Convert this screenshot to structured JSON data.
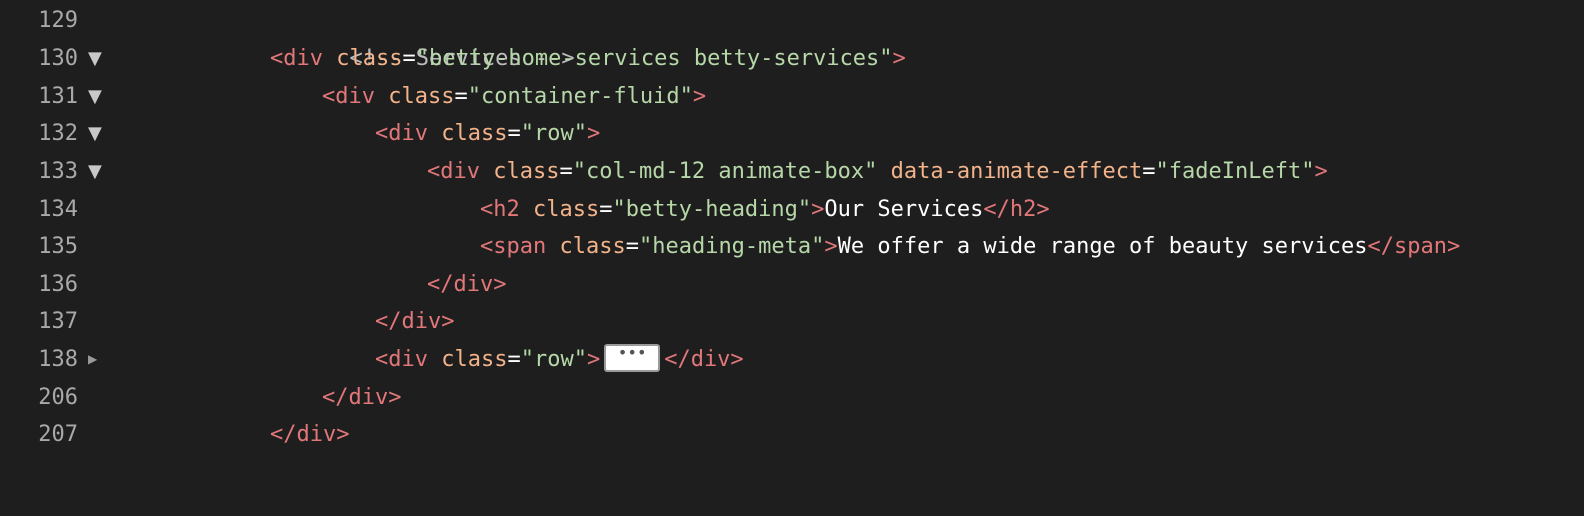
{
  "editor": {
    "lines": [
      {
        "num": "129",
        "fold": "",
        "parts": [
          "<!-- Services -->"
        ]
      },
      {
        "num": "130",
        "fold": "▼",
        "parts": [
          "<div",
          " class",
          "=",
          "\"betty-home-services betty-services\"",
          ">"
        ]
      },
      {
        "num": "131",
        "fold": "▼",
        "parts": [
          "<div",
          " class",
          "=",
          "\"container-fluid\"",
          ">"
        ]
      },
      {
        "num": "132",
        "fold": "▼",
        "parts": [
          "<div",
          " class",
          "=",
          "\"row\"",
          ">"
        ]
      },
      {
        "num": "133",
        "fold": "▼",
        "parts": [
          "<div",
          " class",
          "=",
          "\"col-md-12 animate-box\"",
          " data-animate-effect",
          "=",
          "\"fadeInLeft\"",
          ">"
        ]
      },
      {
        "num": "134",
        "fold": "",
        "parts": [
          "<h2",
          " class",
          "=",
          "\"betty-heading\"",
          ">",
          "Our Services",
          "</h2>"
        ]
      },
      {
        "num": "135",
        "fold": "",
        "parts": [
          "<span",
          " class",
          "=",
          "\"heading-meta\"",
          ">",
          "We offer a wide range of beauty services",
          "</span>"
        ]
      },
      {
        "num": "136",
        "fold": "",
        "parts": [
          "</div>"
        ]
      },
      {
        "num": "137",
        "fold": "",
        "parts": [
          "</div>"
        ]
      },
      {
        "num": "138",
        "fold": "▶",
        "parts": [
          "<div",
          " class",
          "=",
          "\"row\"",
          ">",
          "•••",
          "</div>"
        ]
      },
      {
        "num": "206",
        "fold": "",
        "parts": [
          "</div>"
        ]
      },
      {
        "num": "207",
        "fold": "",
        "parts": [
          "</div>"
        ]
      }
    ]
  }
}
